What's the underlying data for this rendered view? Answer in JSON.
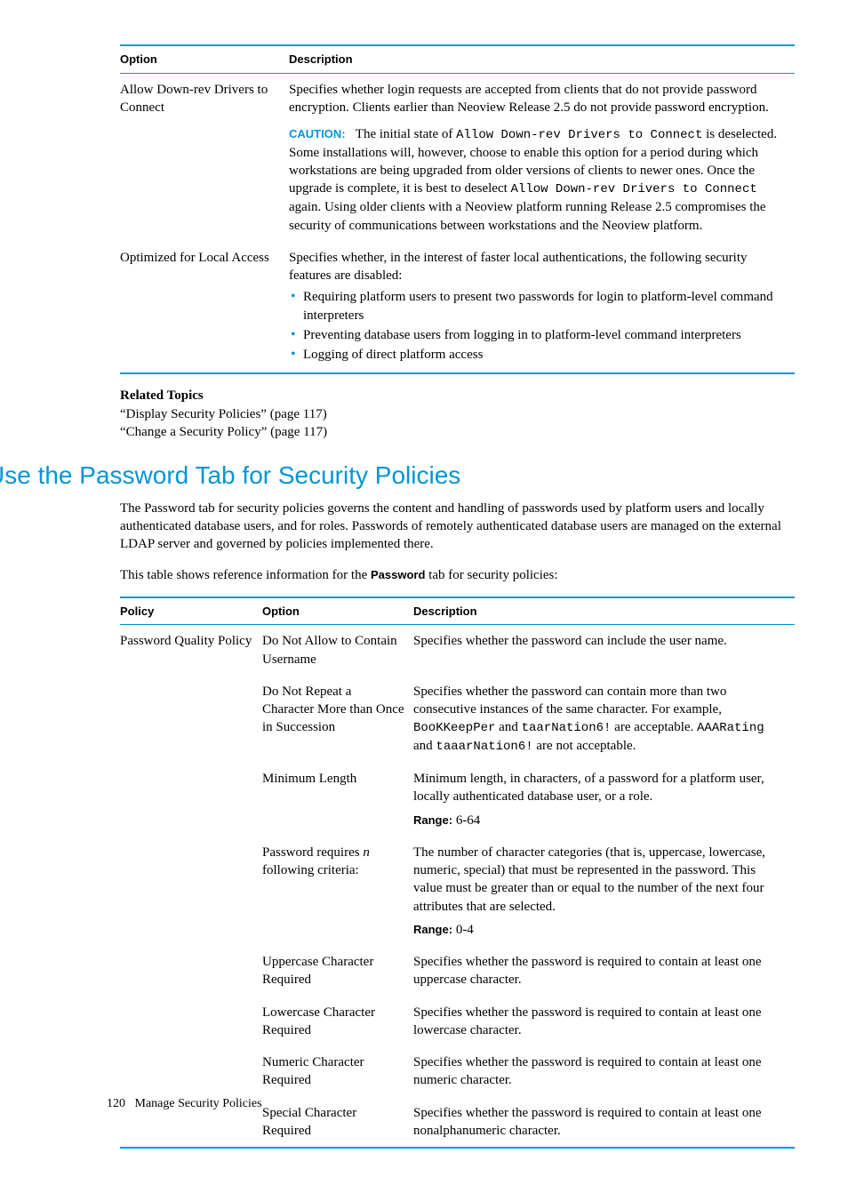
{
  "table1": {
    "headers": [
      "Option",
      "Description"
    ],
    "rows": [
      {
        "option": "Allow Down-rev Drivers to Connect",
        "desc1": "Specifies whether login requests are accepted from clients that do not provide password encryption. Clients earlier than Neoview Release 2.5 do not provide password encryption.",
        "cautionLabel": "CAUTION:",
        "caution_a": "The initial state of ",
        "caution_mono1": "Allow Down-rev Drivers to Connect",
        "caution_b": " is deselected. Some installations will, however, choose to enable this option for a period during which workstations are being upgraded from older versions of clients to newer ones. Once the upgrade is complete, it is best to deselect ",
        "caution_mono2": "Allow Down-rev Drivers to Connect",
        "caution_c": " again. Using older clients with a Neoview platform running Release 2.5 compromises the security of communications between workstations and the Neoview platform."
      },
      {
        "option": "Optimized for Local Access",
        "desc1": "Specifies whether, in the interest of faster local authentications, the following security features are disabled:",
        "bullets": [
          "Requiring platform users to present two passwords for login to platform-level command interpreters",
          "Preventing database users from logging in to platform-level command interpreters",
          "Logging of direct platform access"
        ]
      }
    ]
  },
  "related": {
    "title": "Related Topics",
    "links": [
      "“Display Security Policies” (page 117)",
      "“Change a Security Policy” (page 117)"
    ]
  },
  "heading": "Use the Password Tab for Security Policies",
  "para1": "The Password tab for security policies governs the content and handling of passwords used by platform users and locally authenticated database users, and for roles. Passwords of remotely authenticated database users are managed on the external LDAP server and governed by policies implemented there.",
  "para2_a": "This table shows reference information for the ",
  "para2_bold": "Password",
  "para2_b": " tab for security policies:",
  "table2": {
    "headers": [
      "Policy",
      "Option",
      "Description"
    ],
    "policy": "Password Quality Policy",
    "rows": [
      {
        "option": "Do Not Allow to Contain Username",
        "desc": "Specifies whether the password can include the user name."
      },
      {
        "option": "Do Not Repeat a Character More than Once in Succession",
        "desc_a": "Specifies whether the password can contain more than two consecutive instances of the same character. For example, ",
        "mono1": "BooKKeepPer",
        "desc_b": " and ",
        "mono2": "taarNation6!",
        "desc_c": " are acceptable. ",
        "mono3": "AAARating",
        "desc_d": " and ",
        "mono4": "taaarNation6!",
        "desc_e": " are not acceptable."
      },
      {
        "option": "Minimum Length",
        "desc": "Minimum length, in characters, of a password for a platform user, locally authenticated database user, or a role.",
        "rangeLabel": "Range:",
        "range": " 6-64"
      },
      {
        "option_a": "Password requires ",
        "option_italic": "n",
        "option_b": " following criteria:",
        "desc": "The number of character categories (that is, uppercase, lowercase, numeric, special) that must be represented in the password. This value must be greater than or equal to the number of the next four attributes that are selected.",
        "rangeLabel": "Range:",
        "range": " 0-4"
      },
      {
        "option": "Uppercase Character Required",
        "desc": "Specifies whether the password is required to contain at least one uppercase character."
      },
      {
        "option": "Lowercase Character Required",
        "desc": "Specifies whether the password is required to contain at least one lowercase character."
      },
      {
        "option": "Numeric Character Required",
        "desc": "Specifies whether the password is required to contain at least one numeric character."
      },
      {
        "option": "Special Character Required",
        "desc": "Specifies whether the password is required to contain at least one nonalphanumeric character."
      }
    ]
  },
  "footer": {
    "page": "120",
    "chapter": "Manage Security Policies"
  }
}
